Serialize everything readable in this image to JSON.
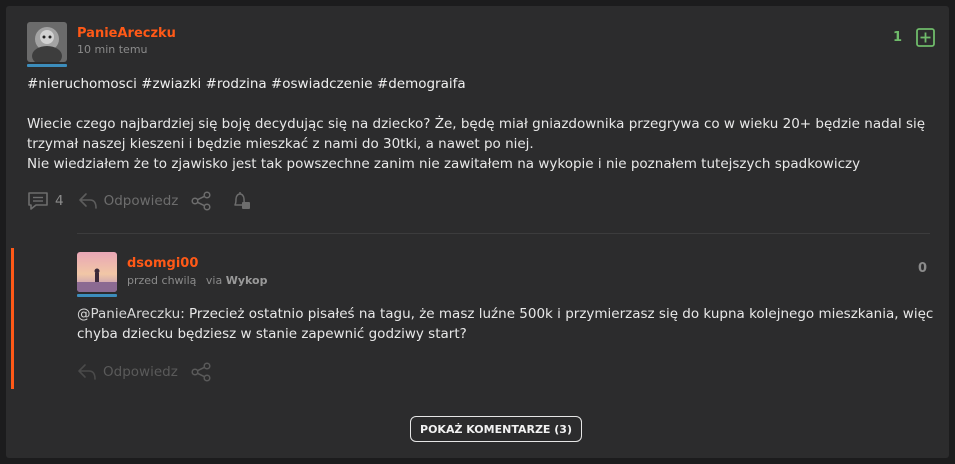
{
  "post": {
    "author": "PanieAreczku",
    "time": "10 min temu",
    "votes": "1",
    "tags": "#nieruchomosci #zwiazki #rodzina #oswiadczenie #demograifa",
    "body_lines": [
      "Wiecie czego najbardziej się boję decydując się na dziecko? Że, będę miał gniazdownika przegrywa co w wieku 20+ będzie nadal się",
      "trzymał naszej kieszeni i będzie mieszkać z nami do 30tki, a nawet po niej.",
      "Nie wiedziałem że to zjawisko jest tak powszechne zanim nie zawitałem na wykopie i nie poznałem tutejszych spadkowiczy"
    ],
    "comments_count": "4",
    "reply_label": "Odpowiedz"
  },
  "comment": {
    "author": "dsomgi00",
    "time": "przed chwilą",
    "via_label": "via",
    "via_source": "Wykop",
    "votes": "0",
    "mention": "@PanieAreczku",
    "body_line1": ": Przecież ostatnio pisałeś na tagu, że masz luźne 500k i przymierzasz się do kupna kolejnego mieszkania, więc",
    "body_line2": "chyba dziecku będziesz w stanie zapewnić godziwy start?",
    "reply_label": "Odpowiedz"
  },
  "show_comments_button": "POKAŻ KOMENTARZE (3)",
  "colors": {
    "accent_orange": "#ff5917",
    "vote_green": "#6fbb6a",
    "card_bg": "#2c2c2d"
  },
  "icons": [
    "plus-box-icon",
    "comments-icon",
    "reply-icon",
    "share-icon",
    "bell-icon"
  ]
}
